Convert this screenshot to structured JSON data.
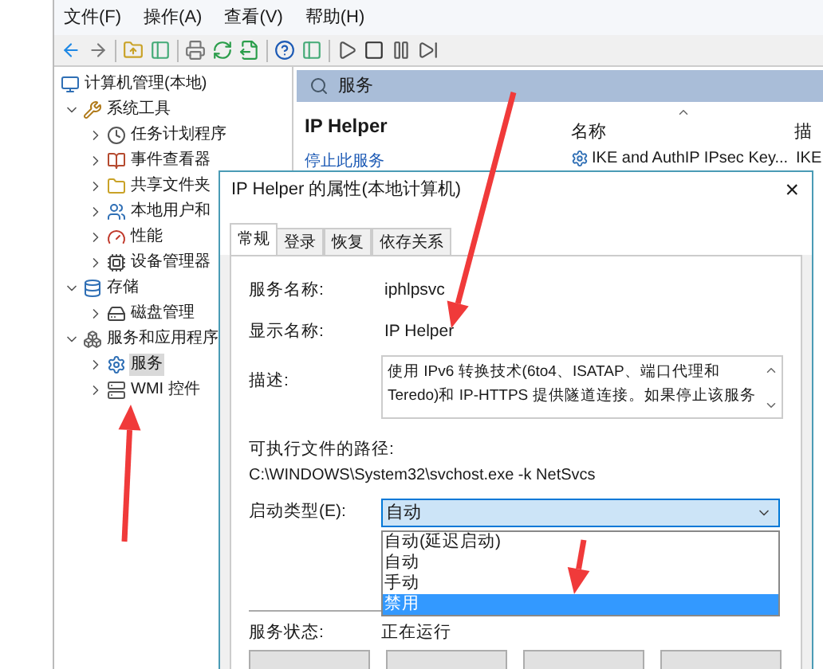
{
  "menu": [
    "文件(F)",
    "操作(A)",
    "查看(V)",
    "帮助(H)"
  ],
  "tree": [
    {
      "label": "计算机管理(本地)",
      "selected": false,
      "children": [
        {
          "label": "系统工具",
          "expanded": true,
          "selected": false,
          "children": [
            {
              "label": "任务计划程序",
              "expanded": false,
              "selected": false
            },
            {
              "label": "事件查看器",
              "expanded": false,
              "selected": false
            },
            {
              "label": "共享文件夹",
              "expanded": false,
              "selected": false
            },
            {
              "label": "本地用户和",
              "expanded": false,
              "selected": false
            },
            {
              "label": "性能",
              "expanded": false,
              "selected": false
            },
            {
              "label": "设备管理器",
              "expanded": false,
              "selected": false
            }
          ]
        },
        {
          "label": "存储",
          "expanded": true,
          "selected": false,
          "children": [
            {
              "label": "磁盘管理",
              "expanded": false,
              "selected": false
            }
          ]
        },
        {
          "label": "服务和应用程序",
          "expanded": true,
          "selected": false,
          "children": [
            {
              "label": "服务",
              "expanded": false,
              "selected": true
            },
            {
              "label": "WMI 控件",
              "expanded": false,
              "selected": false
            }
          ]
        }
      ]
    }
  ],
  "services_pane": {
    "header": "服务",
    "service_title": "IP Helper",
    "stop_link": "停止此服务",
    "columns": [
      "名称",
      "描"
    ],
    "rows": [
      {
        "name": "IKE and AuthIP IPsec Key...",
        "column_2": "IKE"
      }
    ]
  },
  "dialog": {
    "title": "IP Helper 的属性(本地计算机)",
    "close": "×",
    "tabs": [
      {
        "label": "常规",
        "selected": true
      },
      {
        "label": "登录",
        "selected": false
      },
      {
        "label": "恢复",
        "selected": false
      },
      {
        "label": "依存关系",
        "selected": false
      }
    ],
    "service_name_label": "服务名称:",
    "service_name": "iphlpsvc",
    "display_name_label": "显示名称:",
    "display_name": "IP Helper",
    "description_label": "描述:",
    "description_lines": [
      "使用 IPv6 转换技术(6to4、ISATAP、端口代理和",
      "Teredo)和 IP-HTTPS 提供隧道连接。如果停止该服务"
    ],
    "path_label": "可执行文件的路径:",
    "path": "C:\\WINDOWS\\System32\\svchost.exe -k NetSvcs",
    "startup_label": "启动类型(E):",
    "startup_value": "自动",
    "startup_options": [
      {
        "label": "自动(延迟启动)",
        "selected": false
      },
      {
        "label": "自动",
        "selected": false
      },
      {
        "label": "手动",
        "selected": false
      },
      {
        "label": "禁用",
        "selected": true
      }
    ],
    "status_label": "服务状态:",
    "status": "正在运行"
  }
}
